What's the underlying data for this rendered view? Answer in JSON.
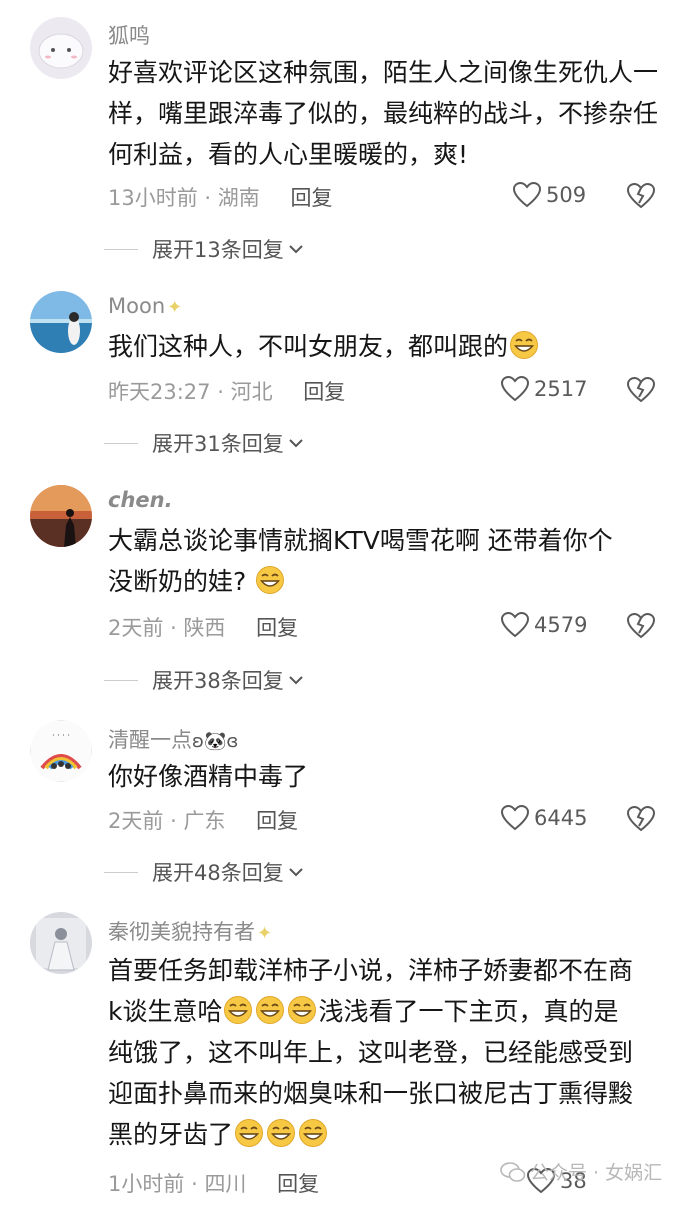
{
  "comments": [
    {
      "username": "狐鸣",
      "text": "好喜欢评论区这种氛围，陌生人之间像生死仇人一样，嘴里跟淬毒了似的，最纯粹的战斗，不掺杂任何利益，看的人心里暖暖的，爽!",
      "time": "13小时前",
      "location": "湖南",
      "reply_label": "回复",
      "likes": "509",
      "expand_label": "展开13条回复"
    },
    {
      "username": "Moon",
      "text": "我们这种人，不叫女朋友，都叫跟的",
      "time": "昨天23:27",
      "location": "河北",
      "reply_label": "回复",
      "likes": "2517",
      "expand_label": "展开31条回复"
    },
    {
      "username": "chen.",
      "text_line1": "大霸总谈论事情就搁KTV喝雪花啊 还带着你个",
      "text_line2": "没断奶的娃?",
      "time": "2天前",
      "location": "陕西",
      "reply_label": "回复",
      "likes": "4579",
      "expand_label": "展开38条回复"
    },
    {
      "username": "清醒一点",
      "text": "你好像酒精中毒了",
      "time": "2天前",
      "location": "广东",
      "reply_label": "回复",
      "likes": "6445",
      "expand_label": "展开48条回复"
    },
    {
      "username": "秦彻美貌持有者",
      "text_line1": "首要任务卸载洋柿子小说，洋柿子娇妻都不在商",
      "text_line2a": "k谈生意哈",
      "text_line2b": "浅浅看了一下主页，真的是",
      "text_line3": "纯饿了，这不叫年上，这叫老登，已经能感受到",
      "text_line4": "迎面扑鼻而来的烟臭味和一张口被尼古丁熏得黢",
      "text_line5": "黑的牙齿了",
      "time": "1小时前",
      "location": "四川",
      "reply_label": "回复",
      "likes": "38"
    }
  ],
  "separator": "·",
  "watermark": "公众号 · 女娲汇",
  "icons": {
    "like": "heart-outline-icon",
    "dislike": "broken-heart-icon",
    "expand": "chevron-down-icon",
    "emoji": "grinning-sweat-emoji"
  },
  "colors": {
    "text": "#161616",
    "meta": "#9a9a9a",
    "username": "#8a8a8a"
  }
}
